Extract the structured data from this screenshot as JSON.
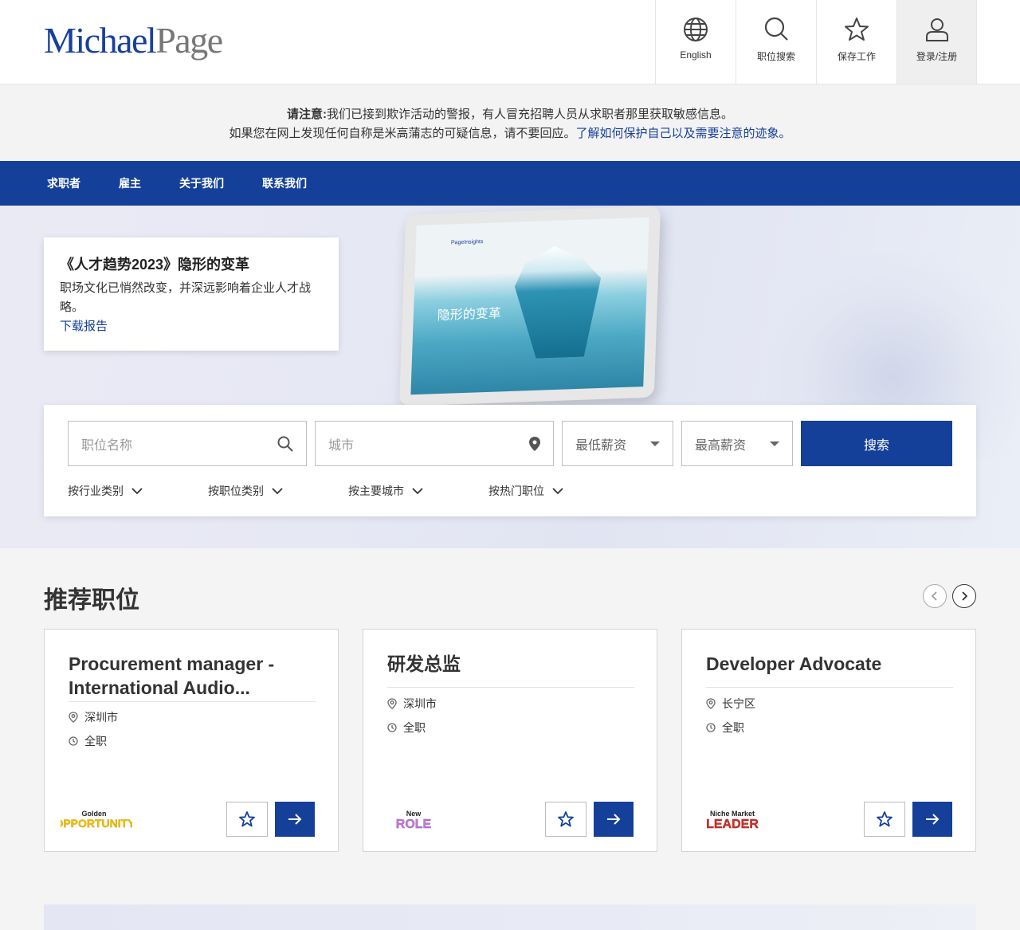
{
  "header": {
    "logo_part1": "Michael",
    "logo_part2": "Page",
    "icons": [
      {
        "label": "English",
        "icon": "globe-icon"
      },
      {
        "label": "职位搜索",
        "icon": "search-icon"
      },
      {
        "label": "保存工作",
        "icon": "star-icon"
      },
      {
        "label": "登录/注册",
        "icon": "user-icon"
      }
    ]
  },
  "notice": {
    "bold": "请注意:",
    "line1": "我们已接到欺诈活动的警报，有人冒充招聘人员从求职者那里获取敏感信息。",
    "line2": "如果您在网上发现任何自称是米高蒲志的可疑信息，请不要回应。",
    "link": "了解如何保护自己以及需要注意的迹象。"
  },
  "nav": {
    "items": [
      "求职者",
      "雇主",
      "关于我们",
      "联系我们"
    ]
  },
  "promo": {
    "title": "《人才趋势2023》隐形的变革",
    "body": "职场文化已悄然改变，并深远影响着企业人才战略。",
    "link": "下载报告",
    "tablet_brand": "PageInsights",
    "tablet_title": "隐形的变革"
  },
  "search": {
    "job_placeholder": "职位名称",
    "city_placeholder": "城市",
    "min_salary": "最低薪资",
    "max_salary": "最高薪资",
    "button": "搜索",
    "filters": [
      "按行业类别",
      "按职位类别",
      "按主要城市",
      "按热门职位"
    ]
  },
  "recommended": {
    "title": "推荐职位",
    "cards": [
      {
        "title": "Procurement manager - International Audio...",
        "location": "深圳市",
        "type": "全职",
        "badge_top": "Golden",
        "badge_bottom": "OPPORTUNITY",
        "badge_color": "#f2c200"
      },
      {
        "title": "研发总监",
        "location": "深圳市",
        "type": "全职",
        "badge_top": "New",
        "badge_bottom": "ROLE",
        "badge_color": "#c07ad6"
      },
      {
        "title": "Developer Advocate",
        "location": "长宁区",
        "type": "全职",
        "badge_top": "Niche Market",
        "badge_bottom": "LEADER",
        "badge_color": "#d2312a"
      }
    ]
  },
  "colors": {
    "brand_blue": "#15409a",
    "logo_grey": "#777777"
  }
}
